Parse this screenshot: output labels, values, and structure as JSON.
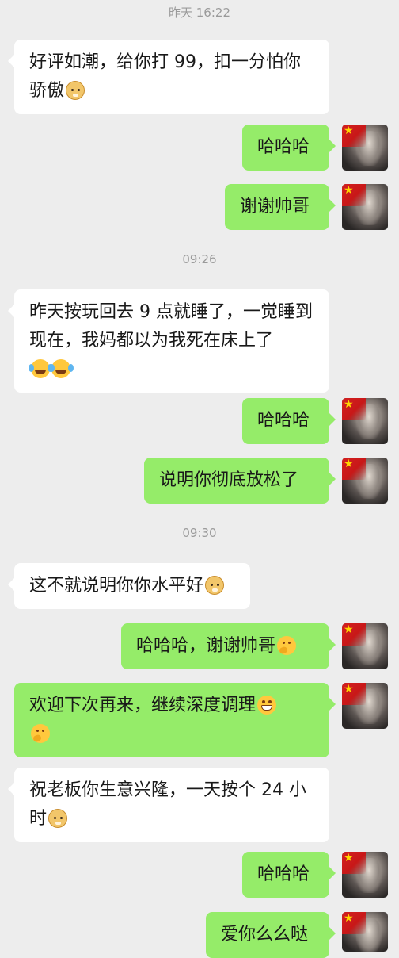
{
  "chat": {
    "timestamps": [
      "昨天 16:22",
      "09:26",
      "09:30"
    ],
    "messages": [
      {
        "side": "in",
        "text": "好评如潮，给你打 99，扣一分怕你骄傲",
        "emoji": [
          "doge"
        ]
      },
      {
        "side": "out",
        "text": "哈哈哈"
      },
      {
        "side": "out",
        "text": "谢谢帅哥"
      },
      {
        "side": "in",
        "text": "昨天按玩回去 9 点就睡了，一觉睡到现在，我妈都以为我死在床上了",
        "emoji": [
          "laugh-cry",
          "laugh-cry"
        ]
      },
      {
        "side": "out",
        "text": "哈哈哈"
      },
      {
        "side": "out",
        "text": "说明你彻底放松了"
      },
      {
        "side": "in",
        "text": "这不就说明你你水平好",
        "emoji": [
          "doge"
        ]
      },
      {
        "side": "out",
        "text": "哈哈哈，谢谢帅哥",
        "emoji": [
          "think"
        ]
      },
      {
        "side": "out",
        "text": "欢迎下次再来，继续深度调理",
        "emoji": [
          "grin",
          "think"
        ]
      },
      {
        "side": "in",
        "text": "祝老板你生意兴隆，一天按个 24 小时",
        "emoji": [
          "doge"
        ]
      },
      {
        "side": "out",
        "text": "哈哈哈"
      },
      {
        "side": "out",
        "text": "爱你么么哒"
      }
    ]
  },
  "colors": {
    "background": "#ededed",
    "incoming_bubble": "#ffffff",
    "outgoing_bubble": "#95ec69",
    "timestamp_text": "#9a9a9a"
  }
}
